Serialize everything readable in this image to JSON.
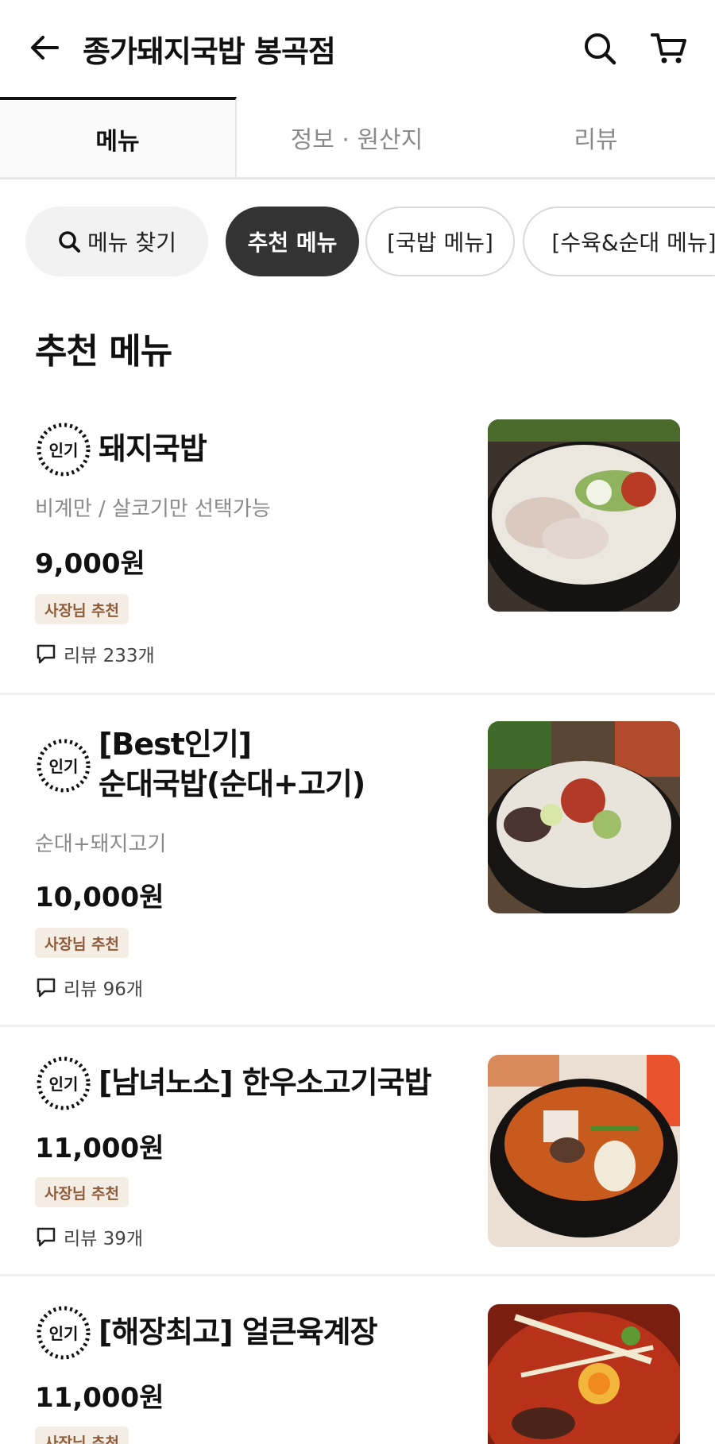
{
  "header": {
    "title": "종가돼지국밥 봉곡점",
    "back_icon": "arrow-left-icon",
    "search_icon": "search-icon",
    "cart_icon": "cart-icon"
  },
  "tabs": [
    {
      "label": "메뉴",
      "active": true
    },
    {
      "label": "정보 · 원산지",
      "active": false
    },
    {
      "label": "리뷰",
      "active": false
    }
  ],
  "chips": {
    "search_label": "메뉴 찾기",
    "categories": [
      "추천 메뉴",
      "[국밥 메뉴]",
      "[수육&순대 메뉴]"
    ],
    "selected": "추천 메뉴"
  },
  "section": {
    "title": "추천 메뉴"
  },
  "popular_badge": "인기",
  "menu_items": [
    {
      "name": "돼지국밥",
      "description": "비계만 / 살코기만 선택가능",
      "price": "9,000원",
      "tag": "사장님 추천",
      "review": "리뷰 233개"
    },
    {
      "name_line1": "[Best인기]",
      "name_line2": "순대국밥(순대+고기)",
      "description": "순대+돼지고기",
      "price": "10,000원",
      "tag": "사장님 추천",
      "review": "리뷰 96개"
    },
    {
      "name": "[남녀노소] 한우소고기국밥",
      "price": "11,000원",
      "tag": "사장님 추천",
      "review": "리뷰 39개"
    },
    {
      "name": "[해장최고] 얼큰육계장",
      "price": "11,000원",
      "tag": "사장님 추천"
    }
  ],
  "colors": {
    "accent_dark": "#333333",
    "tag_bg": "#f4ede4",
    "tag_text": "#8d5c3b"
  }
}
